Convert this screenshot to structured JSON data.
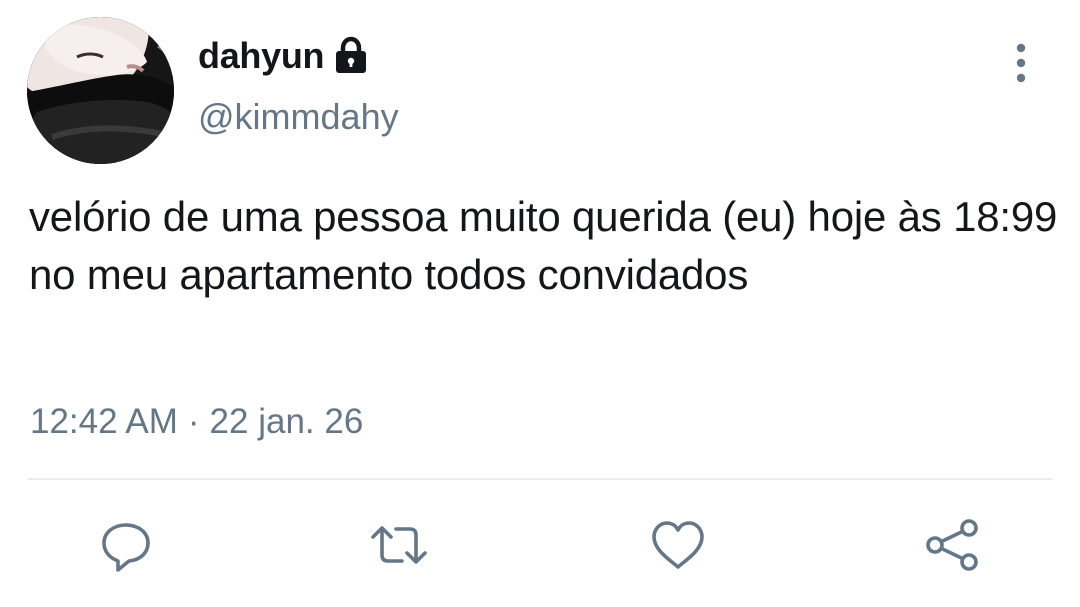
{
  "author": {
    "display_name": "dahyun",
    "handle": "@kimmdahy",
    "avatar_icon": "profile-photo",
    "protected_icon": "lock-icon"
  },
  "tweet": {
    "text": "velório de uma pessoa muito querida (eu) hoje às 18:99 no meu apartamento todos convidados",
    "time": "12:42 AM",
    "separator": "·",
    "date": "22 jan. 26"
  },
  "actions": [
    {
      "name": "reply",
      "icon": "reply-icon"
    },
    {
      "name": "retweet",
      "icon": "retweet-icon"
    },
    {
      "name": "like",
      "icon": "heart-icon"
    },
    {
      "name": "share",
      "icon": "share-icon"
    }
  ],
  "colors": {
    "text": "#14171a",
    "secondary": "#657786",
    "divider": "#e6ecf0"
  }
}
